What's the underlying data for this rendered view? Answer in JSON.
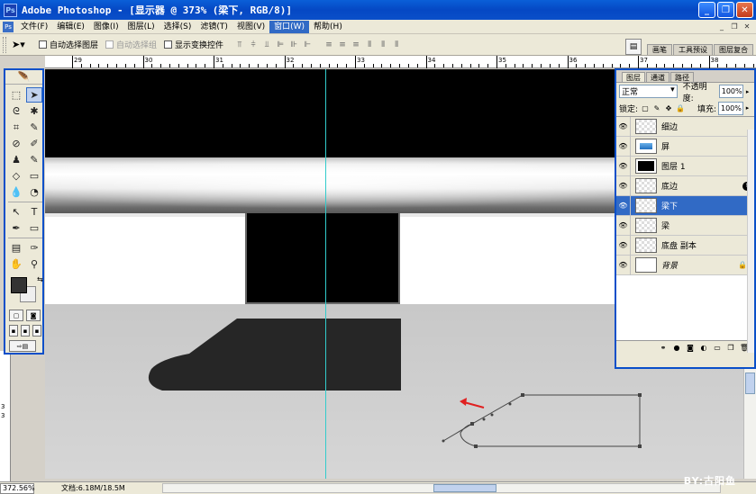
{
  "window": {
    "title": "Adobe Photoshop - [显示器 @ 373% (梁下, RGB/8)]",
    "app_icon": "photoshop-icon",
    "controls": [
      "minimize",
      "restore",
      "close"
    ]
  },
  "menu": {
    "items": [
      "文件(F)",
      "编辑(E)",
      "图像(I)",
      "图层(L)",
      "选择(S)",
      "滤镜(T)",
      "视图(V)",
      "窗口(W)",
      "帮助(H)"
    ],
    "active_index": 7
  },
  "options": {
    "auto_select_layer": "自动选择图层",
    "auto_select_group": "自动选择组",
    "show_transform": "显示变换控件",
    "well_tabs": [
      "画笔",
      "工具预设",
      "图层复合"
    ]
  },
  "ruler": {
    "labels": [
      "29",
      "30",
      "31",
      "32",
      "33",
      "34",
      "35",
      "36",
      "37",
      "38"
    ],
    "left_labels": [
      "3",
      "3"
    ]
  },
  "layers_panel": {
    "tabs": [
      "图层",
      "通道",
      "路径"
    ],
    "blend_mode": "正常",
    "opacity_label": "不透明度:",
    "opacity_value": "100%",
    "lock_label": "锁定:",
    "fill_label": "填充:",
    "fill_value": "100%",
    "layers": [
      {
        "name": "细边",
        "thumb": "transparent",
        "selected": false
      },
      {
        "name": "屏",
        "thumb": "blue",
        "selected": false
      },
      {
        "name": "图层 1",
        "thumb": "black",
        "selected": false
      },
      {
        "name": "底边",
        "thumb": "transparent",
        "selected": false,
        "fx": true
      },
      {
        "name": "梁下",
        "thumb": "transparent",
        "selected": true
      },
      {
        "name": "梁",
        "thumb": "transparent",
        "selected": false
      },
      {
        "name": "底盘 副本",
        "thumb": "transparent",
        "selected": false
      },
      {
        "name": "背景",
        "thumb": "white",
        "selected": false,
        "locked": true
      }
    ]
  },
  "status": {
    "zoom": "372.56%",
    "doc_info": "文档:6.18M/18.5M"
  },
  "watermark": "BY:古阳鱼",
  "colors": {
    "titlebar": "#0548c4",
    "selection": "#316ac5",
    "guide": "#33cccc",
    "arrow": "#e02020"
  }
}
